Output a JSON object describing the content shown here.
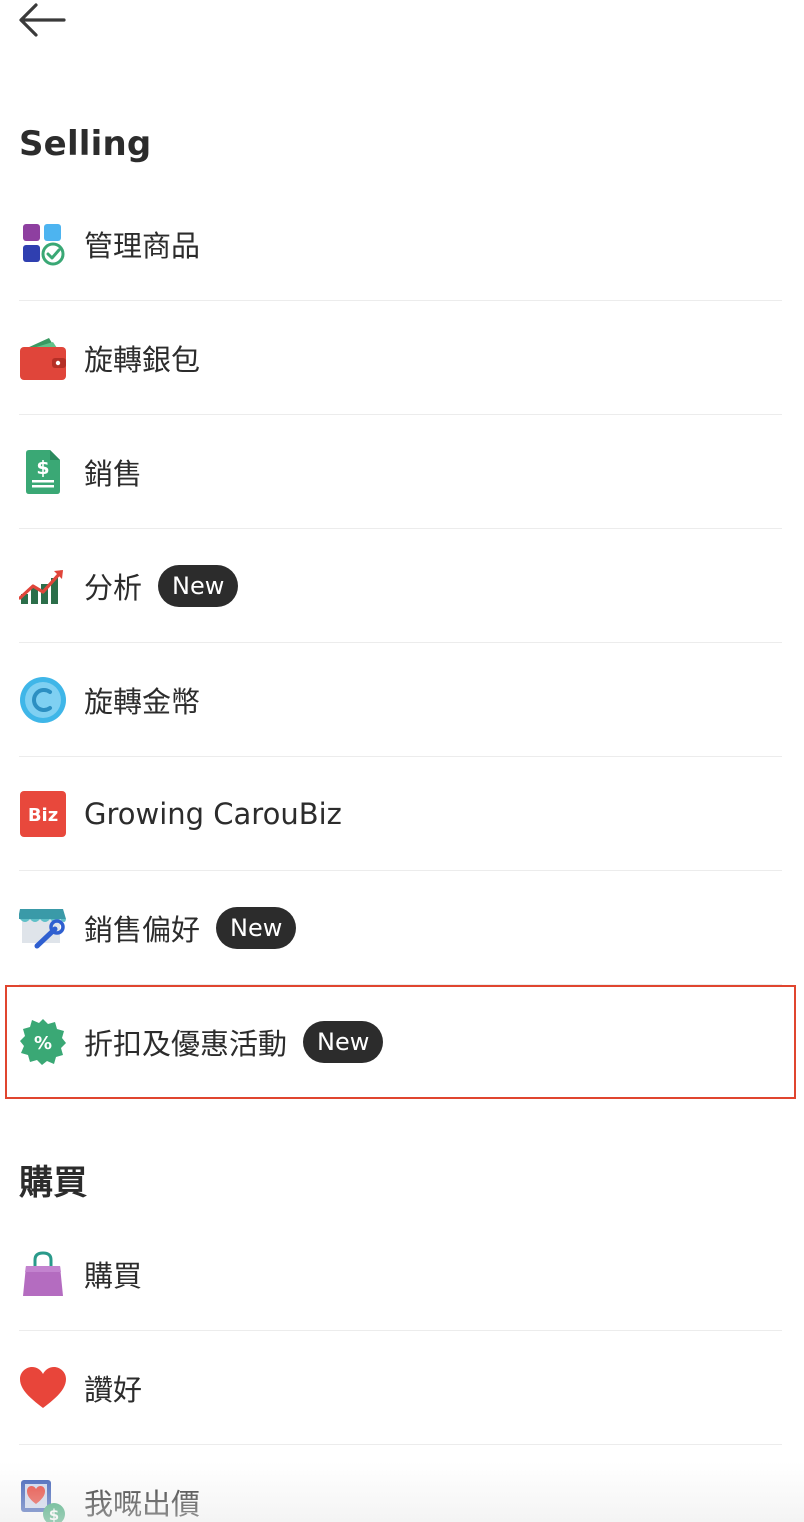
{
  "header": {
    "back_icon": "arrow-left-icon"
  },
  "selling": {
    "title": "Selling",
    "items": [
      {
        "label": "管理商品",
        "icon": "manage-listings-icon",
        "badge": ""
      },
      {
        "label": "旋轉銀包",
        "icon": "wallet-icon",
        "badge": ""
      },
      {
        "label": "銷售",
        "icon": "sales-document-icon",
        "badge": ""
      },
      {
        "label": "分析",
        "icon": "analytics-chart-icon",
        "badge": "New"
      },
      {
        "label": "旋轉金幣",
        "icon": "coin-icon",
        "badge": ""
      },
      {
        "label": "Growing CarouBiz",
        "icon": "biz-icon",
        "icon_text": "Biz",
        "badge": ""
      },
      {
        "label": "銷售偏好",
        "icon": "shop-settings-icon",
        "badge": "New"
      },
      {
        "label": "折扣及優惠活動",
        "icon": "discount-badge-icon",
        "icon_text": "%",
        "badge": "New"
      }
    ]
  },
  "buying": {
    "title": "購買",
    "items": [
      {
        "label": "購買",
        "icon": "shopping-bag-icon"
      },
      {
        "label": "讚好",
        "icon": "heart-icon"
      },
      {
        "label": "我嘅出價",
        "icon": "my-offers-icon"
      }
    ]
  },
  "colors": {
    "highlight_border": "#e0452f",
    "badge_bg": "#2c2c2c",
    "text": "#2c2c2c",
    "divider": "#ececec"
  }
}
